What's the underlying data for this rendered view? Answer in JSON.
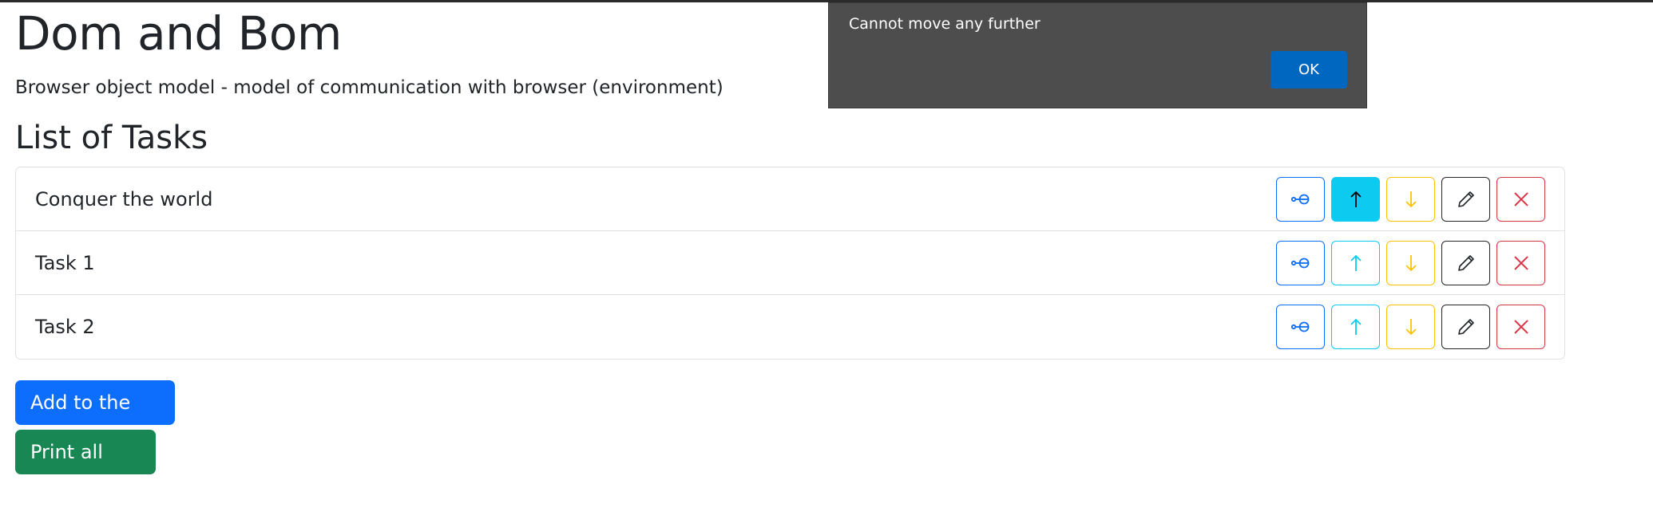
{
  "header": {
    "title": "Dom and Bom",
    "subtitle": "Browser object model - model of communication with browser (environment)"
  },
  "list": {
    "title": "List of Tasks",
    "tasks": [
      {
        "name": "Conquer the world",
        "up_active": true
      },
      {
        "name": "Task 1",
        "up_active": false
      },
      {
        "name": "Task 2",
        "up_active": false
      }
    ]
  },
  "actions": {
    "add_label": "Add to the end",
    "print_label": "Print all tasks"
  },
  "dialog": {
    "message": "Cannot move any further",
    "ok_label": "OK"
  },
  "icons": {
    "link": "link-icon",
    "up": "arrow-up-icon",
    "down": "arrow-down-icon",
    "edit": "pencil-icon",
    "delete": "x-icon"
  },
  "colors": {
    "primary": "#0d6efd",
    "info": "#0dcaf0",
    "warning": "#ffc107",
    "dark": "#212529",
    "danger": "#dc3545",
    "success": "#198754",
    "dialog_bg": "#4d4d4d",
    "dialog_button": "#0067c0"
  }
}
